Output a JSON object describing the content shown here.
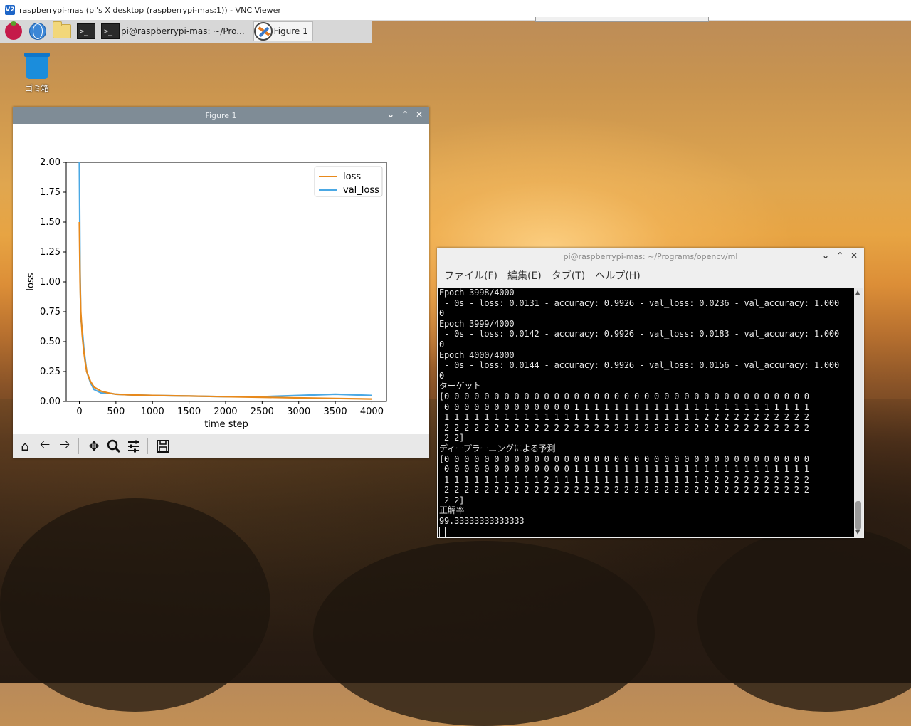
{
  "vnc": {
    "title": "raspberrypi-mas (pi's X desktop (raspberrypi-mas:1)) - VNC Viewer",
    "logo": "V2"
  },
  "taskbar": {
    "terminal_task_label": "pi@raspberrypi-mas: ~/Pro...",
    "figure_task_label": "Figure 1",
    "icons": [
      "raspberry-menu-icon",
      "web-browser-icon",
      "file-manager-icon",
      "terminal-icon"
    ]
  },
  "desktop": {
    "trash_label": "ゴミ箱"
  },
  "figure_window": {
    "title": "Figure 1",
    "toolbar_icons": [
      "home-icon",
      "back-icon",
      "forward-icon",
      "pan-icon",
      "zoom-icon",
      "configure-subplots-icon",
      "save-icon"
    ]
  },
  "chart_data": {
    "type": "line",
    "xlabel": "time step",
    "ylabel": "loss",
    "xlim": [
      -180,
      4200
    ],
    "ylim": [
      0,
      2.0
    ],
    "xticks": [
      "0",
      "500",
      "1000",
      "1500",
      "2000",
      "2500",
      "3000",
      "3500",
      "4000"
    ],
    "yticks": [
      "0.00",
      "0.25",
      "0.50",
      "0.75",
      "1.00",
      "1.25",
      "1.50",
      "1.75",
      "2.00"
    ],
    "legend_position": "top-right",
    "series": [
      {
        "name": "loss",
        "color": "#e8891b",
        "x": [
          0,
          10,
          20,
          40,
          60,
          80,
          100,
          150,
          200,
          300,
          400,
          500,
          700,
          1000,
          1500,
          2000,
          2500,
          3000,
          3500,
          4000
        ],
        "y": [
          1.5,
          1.0,
          0.75,
          0.55,
          0.42,
          0.33,
          0.25,
          0.17,
          0.12,
          0.085,
          0.07,
          0.06,
          0.055,
          0.05,
          0.045,
          0.04,
          0.035,
          0.03,
          0.025,
          0.02
        ]
      },
      {
        "name": "val_loss",
        "color": "#4aa8e4",
        "x": [
          0,
          10,
          20,
          40,
          60,
          80,
          100,
          150,
          200,
          300,
          400,
          500,
          700,
          1000,
          1500,
          2000,
          2500,
          3000,
          3500,
          4000
        ],
        "y": [
          2.0,
          1.1,
          0.7,
          0.6,
          0.45,
          0.35,
          0.25,
          0.16,
          0.1,
          0.07,
          0.07,
          0.06,
          0.055,
          0.05,
          0.045,
          0.04,
          0.04,
          0.05,
          0.06,
          0.05
        ]
      }
    ]
  },
  "terminal": {
    "title": "pi@raspberrypi-mas: ~/Programs/opencv/ml",
    "menu": [
      "ファイル(F)",
      "編集(E)",
      "タブ(T)",
      "ヘルプ(H)"
    ],
    "lines": [
      "Epoch 3998/4000",
      " - 0s - loss: 0.0131 - accuracy: 0.9926 - val_loss: 0.0236 - val_accuracy: 1.000",
      "0",
      "Epoch 3999/4000",
      " - 0s - loss: 0.0142 - accuracy: 0.9926 - val_loss: 0.0183 - val_accuracy: 1.000",
      "0",
      "Epoch 4000/4000",
      " - 0s - loss: 0.0144 - accuracy: 0.9926 - val_loss: 0.0156 - val_accuracy: 1.000",
      "0",
      "ターゲット",
      "[0 0 0 0 0 0 0 0 0 0 0 0 0 0 0 0 0 0 0 0 0 0 0 0 0 0 0 0 0 0 0 0 0 0 0 0 0",
      " 0 0 0 0 0 0 0 0 0 0 0 0 0 1 1 1 1 1 1 1 1 1 1 1 1 1 1 1 1 1 1 1 1 1 1 1 1",
      " 1 1 1 1 1 1 1 1 1 1 1 1 1 1 1 1 1 1 1 1 1 1 1 1 1 1 2 2 2 2 2 2 2 2 2 2 2",
      " 2 2 2 2 2 2 2 2 2 2 2 2 2 2 2 2 2 2 2 2 2 2 2 2 2 2 2 2 2 2 2 2 2 2 2 2 2",
      " 2 2]",
      "ディープラーニングによる予測",
      "[0 0 0 0 0 0 0 0 0 0 0 0 0 0 0 0 0 0 0 0 0 0 0 0 0 0 0 0 0 0 0 0 0 0 0 0 0",
      " 0 0 0 0 0 0 0 0 0 0 0 0 0 1 1 1 1 1 1 1 1 1 1 1 1 1 1 1 1 1 1 1 1 1 1 1 1",
      " 1 1 1 1 1 1 1 1 1 1 2 1 1 1 1 1 1 1 1 1 1 1 1 1 1 1 2 2 2 2 2 2 2 2 2 2 2",
      " 2 2 2 2 2 2 2 2 2 2 2 2 2 2 2 2 2 2 2 2 2 2 2 2 2 2 2 2 2 2 2 2 2 2 2 2 2",
      " 2 2]",
      "正解率",
      "99.33333333333333"
    ]
  }
}
